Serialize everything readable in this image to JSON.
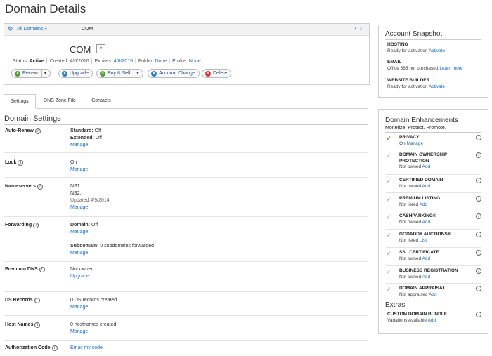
{
  "page": {
    "title": "Domain Details"
  },
  "domain": {
    "breadcrumb_all": "All Domains »",
    "breadcrumb_name": "COM",
    "name": "COM",
    "status_label": "Status:",
    "status_value": "Active",
    "created_label": "Created:",
    "created_value": "4/6/2010",
    "expires_label": "Expires:",
    "expires_value": "4/6/2015",
    "folder_label": "Folder:",
    "folder_value": "None",
    "profile_label": "Profile:",
    "profile_value": "None",
    "buttons": {
      "renew": "Renew",
      "upgrade": "Upgrade",
      "buy_sell": "Buy & Sell",
      "account_change": "Account Change",
      "delete": "Delete"
    }
  },
  "tabs": [
    "Settings",
    "DNS Zone File",
    "Contacts"
  ],
  "settings": {
    "title": "Domain Settings",
    "auto_renew": {
      "label": "Auto-Renew",
      "standard_label": "Standard:",
      "standard_value": "Off",
      "extended_label": "Extended:",
      "extended_value": "Off",
      "action": "Manage"
    },
    "lock": {
      "label": "Lock",
      "value": "On",
      "action": "Manage"
    },
    "nameservers": {
      "label": "Nameservers",
      "ns1": "NS1.",
      "ns2": "NS2..",
      "updated": "Updated 4/9/2014",
      "action": "Manage"
    },
    "forwarding": {
      "label": "Forwarding",
      "domain_label": "Domain:",
      "domain_value": "Off",
      "action1": "Manage",
      "subdomain_label": "Subdomain:",
      "subdomain_value": "0 subdomains forwarded",
      "action2": "Manage"
    },
    "premium_dns": {
      "label": "Premium DNS",
      "value": "Not owned",
      "action": "Upgrade"
    },
    "ds_records": {
      "label": "DS Records",
      "value": "0 DS records created",
      "action": "Manage"
    },
    "host_names": {
      "label": "Host Names",
      "value": "0 hostnames created",
      "action": "Manage"
    },
    "auth_code": {
      "label": "Authorization Code",
      "action": "Email my code"
    }
  },
  "snapshot": {
    "title": "Account Snapshot",
    "items": [
      {
        "heading": "HOSTING",
        "status": "Ready for activation",
        "action": "Activate"
      },
      {
        "heading": "EMAIL",
        "status": "Office 365 not purchased",
        "action": "Learn more"
      },
      {
        "heading": "WEBSITE BUILDER",
        "status": "Ready for activation",
        "action": "Activate"
      }
    ]
  },
  "enhancements": {
    "title": "Domain Enhancements",
    "subtitle": "Monetize. Protect. Promote.",
    "items": [
      {
        "heading": "PRIVACY",
        "status": "On",
        "action": "Manage"
      },
      {
        "heading": "DOMAIN OWNERSHIP PROTECTION",
        "status": "Not owned",
        "action": "Add"
      },
      {
        "heading": "CERTIFIED DOMAIN",
        "status": "Not owned",
        "action": "Add"
      },
      {
        "heading": "PREMIUM LISTING",
        "status": "Not listed",
        "action": "Add"
      },
      {
        "heading": "CASHPARKING®",
        "status": "Not owned",
        "action": "Add"
      },
      {
        "heading": "GODADDY AUCTIONS®",
        "status": "Not listed",
        "action": "List"
      },
      {
        "heading": "SSL CERTIFICATE",
        "status": "Not owned",
        "action": "Add"
      },
      {
        "heading": "BUSINESS REGISTRATION",
        "status": "Not owned",
        "action": "Add"
      },
      {
        "heading": "DOMAIN APPRAISAL",
        "status": "Not appraised",
        "action": "Add"
      }
    ],
    "extras_title": "Extras",
    "extras": [
      {
        "heading": "CUSTOM DOMAIN BUNDLE",
        "status": "Variations Available",
        "action": "Add"
      }
    ]
  },
  "colors": {
    "link": "#1a6fc4",
    "check_on": "#4aa02c",
    "check_off": "#bbbbbb"
  }
}
